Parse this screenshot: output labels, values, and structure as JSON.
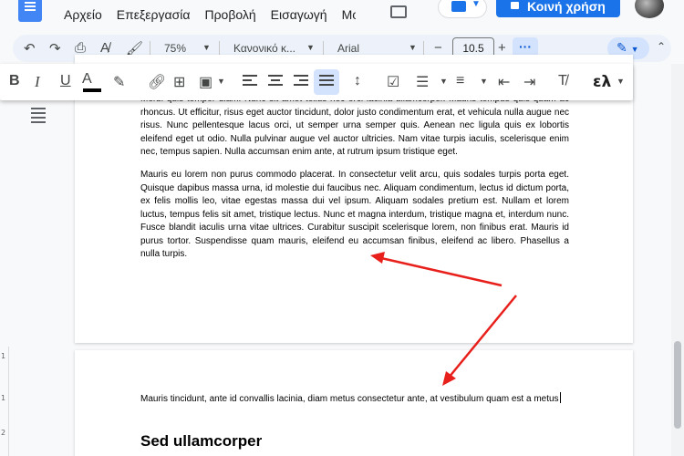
{
  "menu": {
    "items": [
      "Αρχείο",
      "Επεξεργασία",
      "Προβολή",
      "Εισαγωγή",
      "Μορφή"
    ],
    "share_label": "Κοινή χρήση"
  },
  "toolbar": {
    "zoom": "75%",
    "style": "Κανονικό κ...",
    "font": "Arial",
    "font_size": "10.5",
    "minus": "−",
    "plus": "+"
  },
  "format_toolbar": {
    "bold": "B",
    "italic": "I",
    "underline": "U",
    "text_color": "A",
    "language": "ελ"
  },
  "document": {
    "page1": {
      "para1": "Morbi quis tempor diam. Nunc sit amet tellus nec orci lacinia ullamcorper. Mauris tempus quis quam ac rhoncus. Ut efficitur, risus eget auctor tincidunt, dolor justo condimentum erat, et vehicula nulla augue nec risus. Nunc pellentesque lacus orci, ut semper urna semper quis. Aenean nec ligula quis ex lobortis eleifend eget ut odio. Nulla pulvinar augue vel auctor ultricies. Nam vitae turpis iaculis, scelerisque enim nec, tempus sapien. Nulla accumsan enim ante, at rutrum ipsum tristique eget.",
      "para2": "Mauris eu lorem non purus commodo placerat. In consectetur velit arcu, quis sodales turpis porta eget. Quisque dapibus massa urna, id molestie dui faucibus nec. Aliquam condimentum, lectus id dictum porta, ex felis mollis leo, vitae egestas massa dui vel ipsum. Aliquam sodales pretium est. Nullam et lorem luctus, tempus felis sit amet, tristique lectus. Nunc et magna interdum, tristique magna et, interdum nunc. Fusce blandit iaculis urna vitae ultrices. Curabitur suscipit scelerisque lorem, non finibus erat. Mauris id purus tortor. Suspendisse quam mauris, eleifend eu accumsan finibus, eleifend ac libero. Phasellus a nulla turpis."
    },
    "page2": {
      "para1": "Mauris tincidunt, ante id convallis lacinia, diam metus consectetur ante, at vestibulum quam est a metus",
      "heading": "Sed ullamcorper"
    }
  },
  "ruler": [
    "1",
    "1",
    "2"
  ],
  "colors": {
    "accent": "#1a73e8",
    "annotation_arrow": "#e8201c"
  }
}
